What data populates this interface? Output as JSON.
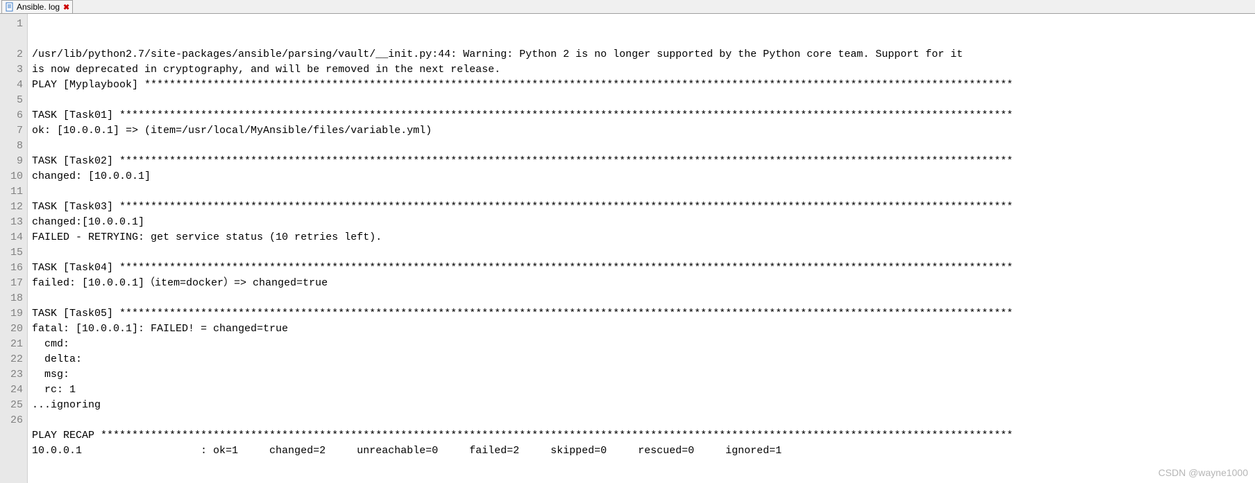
{
  "tab": {
    "filename": "Ansible. log",
    "close_glyph": "✖"
  },
  "lines": [
    "/usr/lib/python2.7/site-packages/ansible/parsing/vault/__init.py:44: Warning: Python 2 is no longer supported by the Python core team. Support for it is now deprecated in cryptography, and will be removed in the next release.",
    "PLAY [Myplaybook] *******************************************************************************************************************************************",
    "",
    "TASK [Task01] ***********************************************************************************************************************************************",
    "ok: [10.0.0.1] => (item=/usr/local/MyAnsible/files/variable.yml)",
    "",
    "TASK [Task02] ***********************************************************************************************************************************************",
    "changed: [10.0.0.1]",
    "",
    "TASK [Task03] ***********************************************************************************************************************************************",
    "changed:[10.0.0.1]",
    "FAILED - RETRYING: get service status (10 retries left).",
    "",
    "TASK [Task04] ***********************************************************************************************************************************************",
    "failed: [10.0.0.1]（item=docker）=> changed=true",
    "",
    "TASK [Task05] ***********************************************************************************************************************************************",
    "fatal: [10.0.0.1]: FAILED! = changed=true",
    "  cmd:",
    "  delta:",
    "  msg:",
    "  rc: 1",
    "...ignoring",
    "",
    "PLAY RECAP **************************************************************************************************************************************************",
    "10.0.0.1                   : ok=1     changed=2     unreachable=0     failed=2     skipped=0     rescued=0     ignored=1"
  ],
  "wrap_width": 150,
  "watermark": "CSDN @wayne1000"
}
